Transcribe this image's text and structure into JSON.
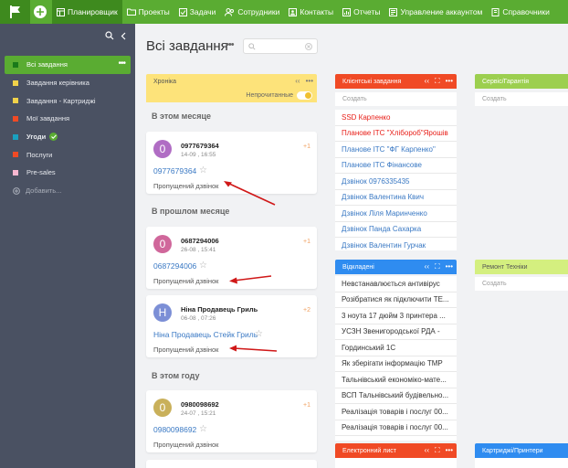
{
  "nav": {
    "items": [
      "Планировщик",
      "Проекты",
      "Задачи",
      "Сотрудники",
      "Контакты",
      "Отчеты",
      "Управление аккаунтом",
      "Справочники"
    ],
    "active": "Планировщик"
  },
  "sidebar": {
    "items": [
      {
        "label": "Всі завдання",
        "color": "#1a7a1a"
      },
      {
        "label": "Завдання керівника",
        "color": "#f1d24a"
      },
      {
        "label": "Завдання - Картриджі",
        "color": "#f1d24a"
      },
      {
        "label": "Мої завдання",
        "color": "#f04a25"
      },
      {
        "label": "Угоди",
        "color": "#1aa0c0"
      },
      {
        "label": "Послуги",
        "color": "#f04a25"
      },
      {
        "label": "Pre-sales",
        "color": "#f7b7d0"
      }
    ],
    "add_label": "Добавить..."
  },
  "main": {
    "title": "Всі завдання",
    "search_placeholder": ""
  },
  "columns": {
    "chronicle": {
      "title": "Хроніка",
      "toggle_label": "Непрочитанные",
      "color": "#fde37a",
      "sections": [
        "В этом месяце",
        "В прошлом месяце",
        "В этом году"
      ],
      "cards": [
        {
          "avatar": "0",
          "avatar_color": "#b06dc4",
          "name": "0977679364",
          "date": "14-09 , 16:55",
          "count": "+1",
          "link": "0977679364",
          "subtitle": "Пропущений дзвінок"
        },
        {
          "avatar": "0",
          "avatar_color": "#d0679b",
          "name": "0687294006",
          "date": "26-08 , 15:41",
          "count": "+1",
          "link": "0687294006",
          "subtitle": "Пропущений дзвінок"
        },
        {
          "avatar": "Н",
          "avatar_color": "#7c8fd6",
          "name": "Ніна Продавець Гриль",
          "date": "06-08 , 07:26",
          "count": "+2",
          "link": "Ніна Продавець Стейк Гриль",
          "subtitle": "Пропущений дзвінок"
        },
        {
          "avatar": "0",
          "avatar_color": "#c9b05a",
          "name": "0980098692",
          "date": "24-07 , 15:21",
          "count": "+1",
          "link": "0980098692",
          "subtitle": "Пропущений дзвінок"
        }
      ]
    },
    "client_tasks": {
      "title": "Клієнтські завдання",
      "color": "#f04a25",
      "create_label": "Создать",
      "rows": [
        {
          "text": "SSD Карпенко",
          "color": "#e8201a"
        },
        {
          "text": "Планове ІТС \"Хлібороб\"Ярошів",
          "color": "#e8201a"
        },
        {
          "text": "Планове ІТС \"ФГ Карпенко\"",
          "color": "#3a79c4"
        },
        {
          "text": "Планове ІТС Фінансове",
          "color": "#3a79c4"
        },
        {
          "text": "Дзвінок 0976335435",
          "color": "#3a79c4"
        },
        {
          "text": "Дзвінок Валентина Квич",
          "color": "#3a79c4"
        },
        {
          "text": "Дзвінок Ліля Маринченко",
          "color": "#3a79c4"
        },
        {
          "text": "Дзвінок Панда Сахарка",
          "color": "#3a79c4"
        },
        {
          "text": "Дзвінок Валентин Гурчак",
          "color": "#3a79c4"
        }
      ]
    },
    "service": {
      "title": "Сервіс/Гарантія",
      "color": "#9ccf4f",
      "create_label": "Создать"
    },
    "postponed": {
      "title": "Відкладені",
      "color": "#2f8cf0",
      "rows": [
        "Невстанавлюється антивірус",
        "Розібратися як підключити TE...",
        "3 ноута 17 дюйм 3 принтера ...",
        "УСЗН Звенигородської РДА -",
        "Гординський 1С",
        "Як зберігати інформацію ТМР",
        "Тальнівський економіко-мате...",
        "ВСП Тальнівський будівельно...",
        "Реалізація товарів і послуг 00...",
        "Реалізація товарів і послуг 00..."
      ]
    },
    "repair": {
      "title": "Ремонт Техніки",
      "color": "#d4ef7f",
      "create_label": "Создать"
    },
    "email": {
      "title": "Електронний лист",
      "color": "#f04a25"
    },
    "cartridges": {
      "title": "Картриджі/Принтери",
      "color": "#2f8cf0"
    }
  }
}
